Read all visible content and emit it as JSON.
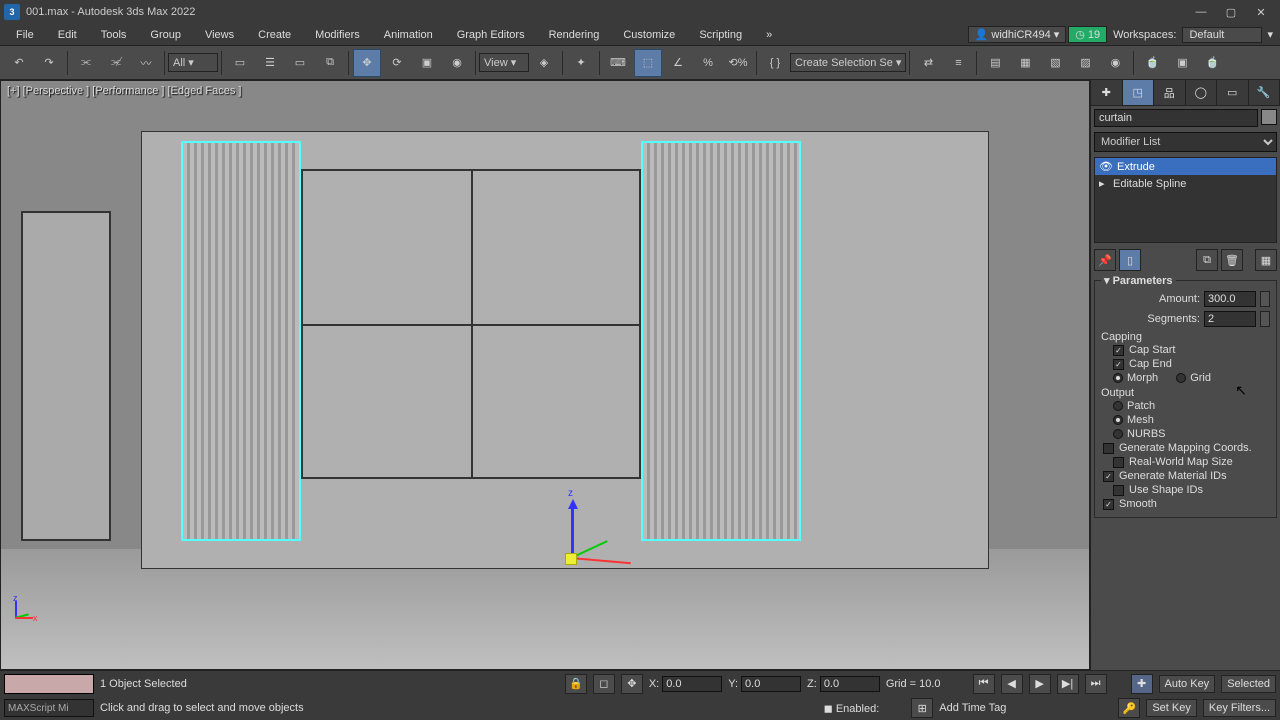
{
  "title_bar": {
    "icon_label": "3",
    "title": "001.max - Autodesk 3ds Max 2022",
    "min": "—",
    "max": "▢",
    "close": "✕"
  },
  "menu": {
    "items": [
      "File",
      "Edit",
      "Tools",
      "Group",
      "Views",
      "Create",
      "Modifiers",
      "Animation",
      "Graph Editors",
      "Rendering",
      "Customize",
      "Scripting"
    ],
    "overflow": "»",
    "user": "widhiCR494",
    "notif_count": "19",
    "workspaces_label": "Workspaces:",
    "workspace": "Default"
  },
  "toolbar": {
    "selset_label": "All",
    "view_label": "View",
    "named_sel": "Create Selection Se"
  },
  "viewport": {
    "labels": "[+] [Perspective ] [Performance ] [Edged Faces ]",
    "z": "z",
    "x": "x"
  },
  "cmd": {
    "object_name": "curtain",
    "modifier_list": "Modifier List",
    "stack": [
      {
        "label": "Extrude",
        "selected": true,
        "eye": true,
        "expand": false
      },
      {
        "label": "Editable Spline",
        "selected": false,
        "eye": false,
        "expand": true
      }
    ],
    "rollout_title": "Parameters",
    "amount_label": "Amount:",
    "amount_value": "300.0",
    "segments_label": "Segments:",
    "segments_value": "2",
    "capping_label": "Capping",
    "cap_start": "Cap Start",
    "cap_end": "Cap End",
    "morph": "Morph",
    "grid": "Grid",
    "output_label": "Output",
    "patch": "Patch",
    "mesh": "Mesh",
    "nurbs": "NURBS",
    "gen_map": "Generate Mapping Coords.",
    "real_world": "Real-World Map Size",
    "gen_mat": "Generate Material IDs",
    "use_shape": "Use Shape IDs",
    "smooth": "Smooth"
  },
  "status": {
    "selection": "1 Object Selected",
    "prompt": "Click and drag to select and move objects",
    "enabled_label": "Enabled:",
    "x_label": "X:",
    "x_val": "0.0",
    "y_label": "Y:",
    "y_val": "0.0",
    "z_label": "Z:",
    "z_val": "0.0",
    "grid_label": "Grid = 10.0",
    "maxscript": "MAXScript Mi",
    "add_time_tag": "Add Time Tag",
    "auto_key": "Auto Key",
    "set_key": "Set Key",
    "selected": "Selected",
    "key_filters": "Key Filters..."
  }
}
